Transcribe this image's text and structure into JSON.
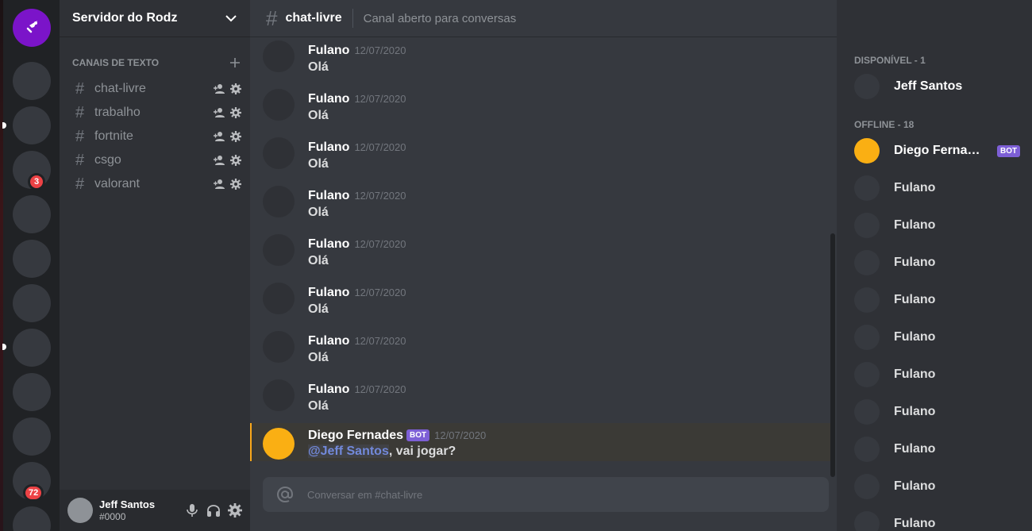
{
  "server_list": {
    "home_icon": "discord-logo-icon",
    "badges": [
      "3",
      "72"
    ]
  },
  "sidebar": {
    "server_name": "Servidor do Rodz",
    "category": "CANAIS DE TEXTO",
    "channels": [
      {
        "name": "chat-livre"
      },
      {
        "name": "trabalho"
      },
      {
        "name": "fortnite"
      },
      {
        "name": "csgo"
      },
      {
        "name": "valorant"
      }
    ],
    "user": {
      "name": "Jeff Santos",
      "tag": "#0000"
    }
  },
  "chat": {
    "channel": "chat-livre",
    "topic": "Canal aberto para conversas",
    "messages": [
      {
        "author": "Fulano",
        "time": "12/07/2020",
        "text": "Olá"
      },
      {
        "author": "Fulano",
        "time": "12/07/2020",
        "text": "Olá"
      },
      {
        "author": "Fulano",
        "time": "12/07/2020",
        "text": "Olá"
      },
      {
        "author": "Fulano",
        "time": "12/07/2020",
        "text": "Olá"
      },
      {
        "author": "Fulano",
        "time": "12/07/2020",
        "text": "Olá"
      },
      {
        "author": "Fulano",
        "time": "12/07/2020",
        "text": "Olá"
      },
      {
        "author": "Fulano",
        "time": "12/07/2020",
        "text": "Olá"
      },
      {
        "author": "Fulano",
        "time": "12/07/2020",
        "text": "Olá"
      }
    ],
    "mention_message": {
      "author": "Diego Fernades",
      "bot_tag": "BOT",
      "time": "12/07/2020",
      "mention": "@Jeff Santos",
      "text": ", vai jogar?"
    },
    "input_placeholder": "Conversar em #chat-livre"
  },
  "members": {
    "online_title": "DISPONÍVEL - 1",
    "online": [
      {
        "name": "Jeff Santos"
      }
    ],
    "offline_title": "OFFLINE - 18",
    "offline": [
      {
        "name": "Diego Fernandes",
        "bot": "BOT"
      },
      {
        "name": "Fulano"
      },
      {
        "name": "Fulano"
      },
      {
        "name": "Fulano"
      },
      {
        "name": "Fulano"
      },
      {
        "name": "Fulano"
      },
      {
        "name": "Fulano"
      },
      {
        "name": "Fulano"
      },
      {
        "name": "Fulano"
      },
      {
        "name": "Fulano"
      },
      {
        "name": "Fulano"
      }
    ]
  },
  "colors": {
    "accent": "#7289da",
    "bot_tag": "#7d5fd6",
    "server_home": "#7b14c9",
    "mention_bar": "#faa81a",
    "bot_avatar": "#faaf13",
    "badge": "#ed4245"
  }
}
